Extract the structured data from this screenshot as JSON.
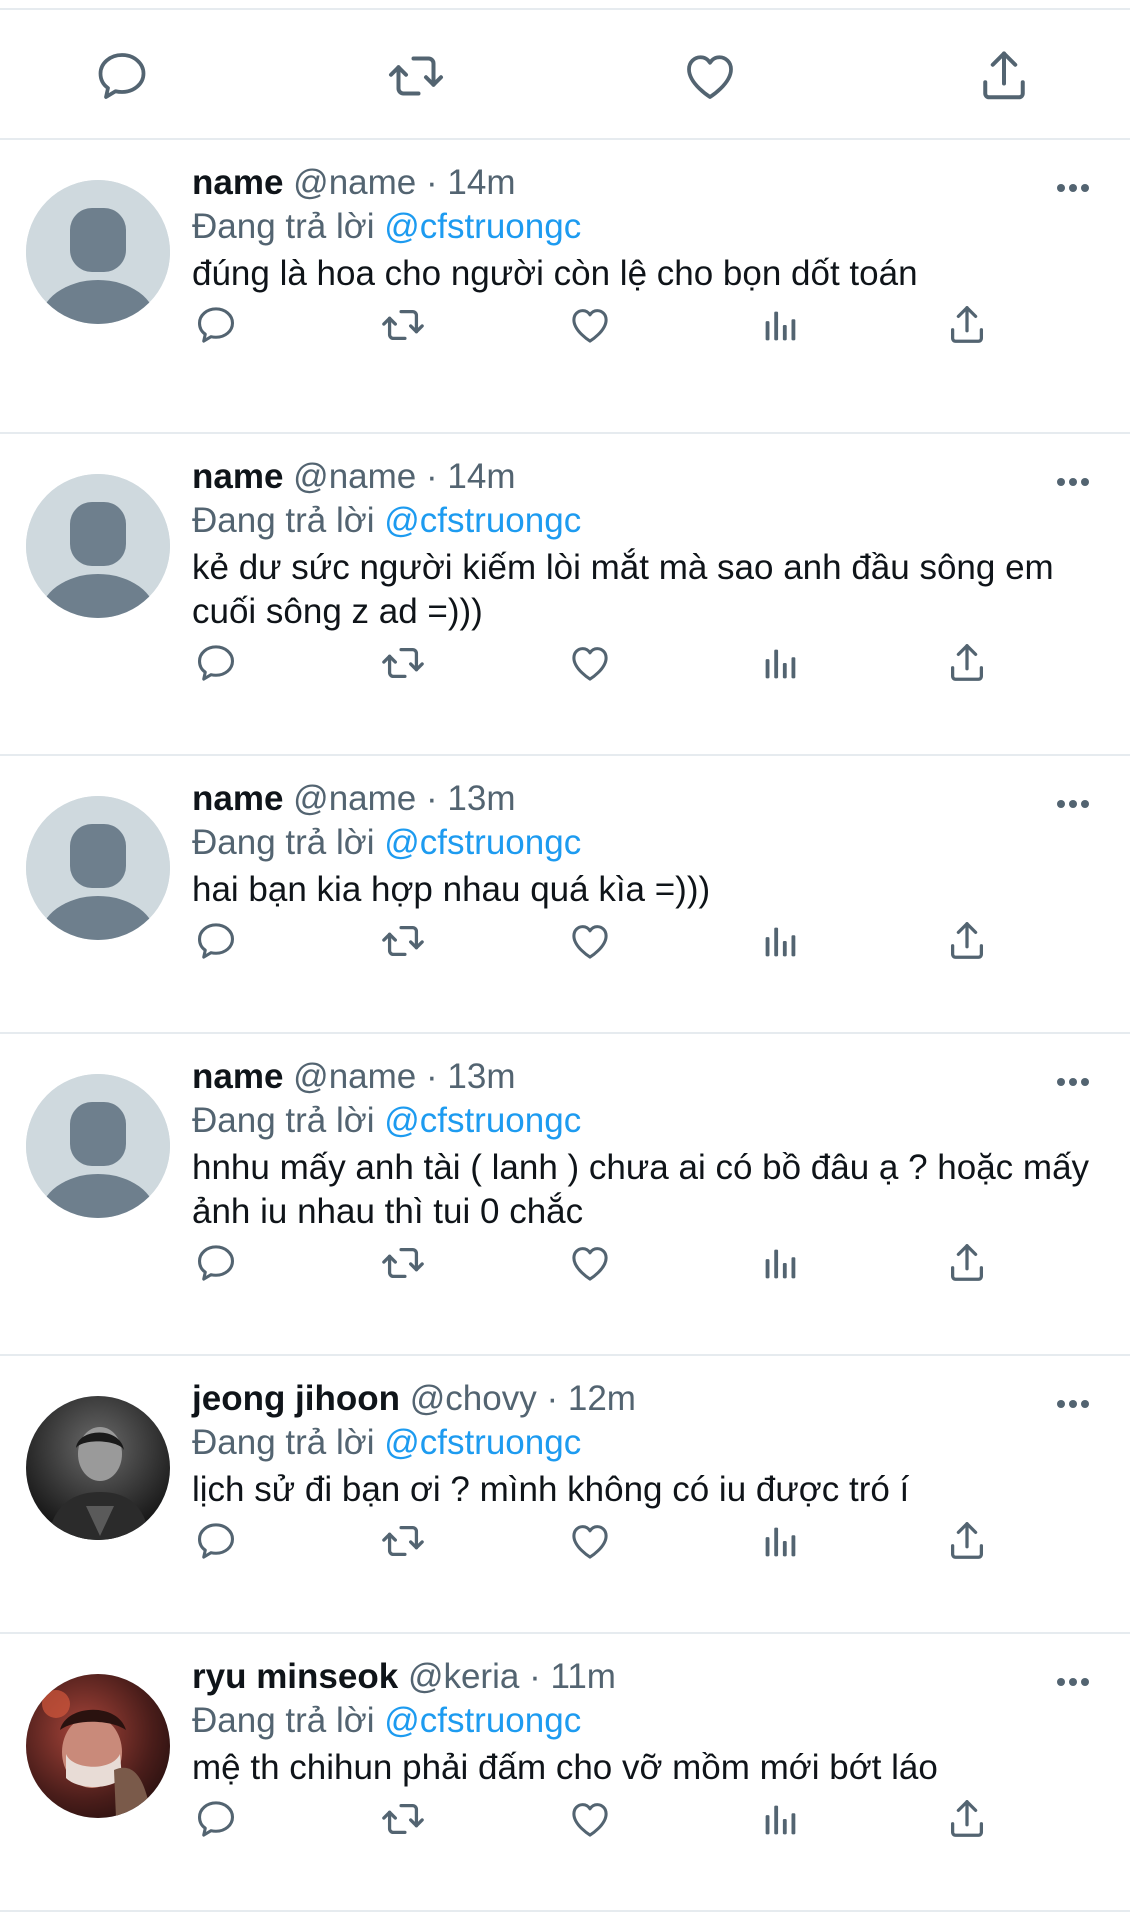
{
  "colors": {
    "text": "#0f1419",
    "secondary": "#536471",
    "link": "#1d9bf0",
    "divider": "#e6ebef",
    "avatar_placeholder": "#cfd9de",
    "avatar_silhouette": "#6e7f8d"
  },
  "top_actions": [
    "reply-icon",
    "retweet-icon",
    "like-icon",
    "share-icon"
  ],
  "tweets": [
    {
      "name": "name",
      "handle": "@name",
      "dot": "·",
      "time": "14m",
      "reply_prefix": "Đang trả lời",
      "reply_to": "@cfstruongc",
      "text": "đúng là hoa cho người còn lệ cho bọn dốt toán",
      "avatar": "default-avatar"
    },
    {
      "name": "name",
      "handle": "@name",
      "dot": "·",
      "time": "14m",
      "reply_prefix": "Đang trả lời",
      "reply_to": "@cfstruongc",
      "text": "kẻ dư sức người kiếm lòi mắt mà sao anh đầu sông em cuối sông z ad =)))",
      "avatar": "default-avatar"
    },
    {
      "name": "name",
      "handle": "@name",
      "dot": "·",
      "time": "13m",
      "reply_prefix": "Đang trả lời",
      "reply_to": "@cfstruongc",
      "text": "hai bạn kia hợp nhau quá kìa =)))",
      "avatar": "default-avatar"
    },
    {
      "name": "name",
      "handle": "@name",
      "dot": "·",
      "time": "13m",
      "reply_prefix": "Đang trả lời",
      "reply_to": "@cfstruongc",
      "text": "hnhu mấy anh tài ( lanh ) chưa ai có bồ đâu ạ ? hoặc mấy ảnh iu nhau thì tui 0 chắc",
      "avatar": "default-avatar"
    },
    {
      "name": "jeong jihoon",
      "handle": "@chovy",
      "dot": "·",
      "time": "12m",
      "reply_prefix": "Đang trả lời",
      "reply_to": "@cfstruongc",
      "text": "lịch sử đi bạn ơi ? mình không có iu được tró í",
      "avatar": "photo-avatar-dark"
    },
    {
      "name": "ryu minseok",
      "handle": "@keria",
      "dot": "·",
      "time": "11m",
      "reply_prefix": "Đang trả lời",
      "reply_to": "@cfstruongc",
      "text": "mệ th chihun phải đấm cho vỡ mồm mới bớt láo",
      "avatar": "photo-avatar-warm"
    }
  ],
  "tweet_actions": [
    "reply-icon",
    "retweet-icon",
    "like-icon",
    "views-icon",
    "share-icon"
  ]
}
